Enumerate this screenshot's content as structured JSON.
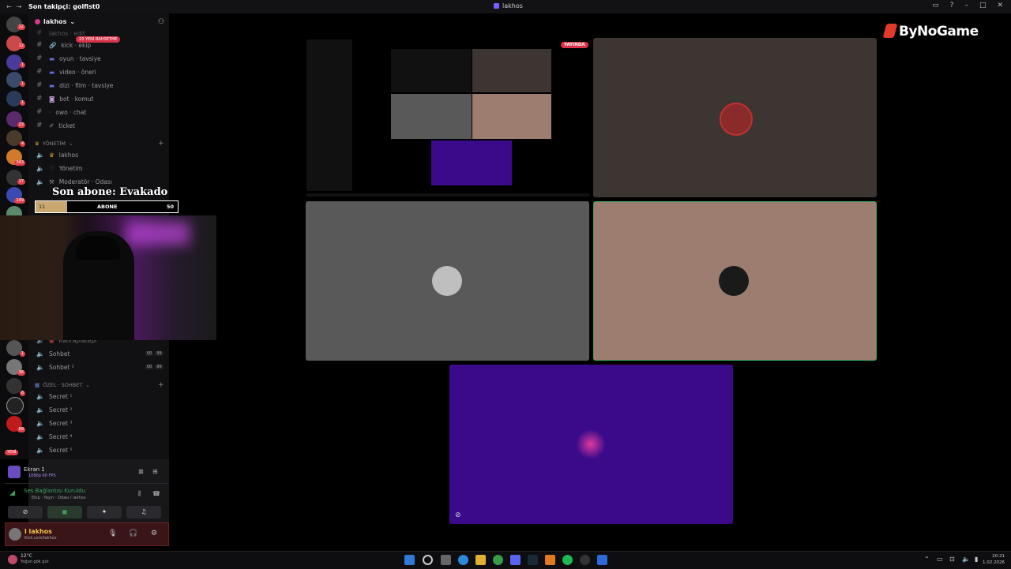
{
  "titlebar": {
    "follower_text": "Son takipçi: golfist0",
    "window_title": "lakhos"
  },
  "server_rail": {
    "badges": [
      "12",
      "12",
      "1",
      "1",
      "1",
      "23",
      "4",
      "343",
      "17",
      "149",
      "1",
      "36",
      "6",
      "69"
    ],
    "new_label": "YENİ"
  },
  "guild": {
    "name": "lakhos"
  },
  "channels": {
    "top_partial": "lakhos · edit",
    "pill": "23 YENİ BAHSETME",
    "text_channels": [
      {
        "name": "kick · ekip",
        "icon": "link-icon"
      },
      {
        "name": "oyun · tavsiye",
        "icon": "gamepad-icon"
      },
      {
        "name": "video · öneri",
        "icon": "video-icon"
      },
      {
        "name": "dizi · film · tavsiye",
        "icon": "film-icon"
      },
      {
        "name": "bot · komut",
        "icon": "robot-icon"
      },
      {
        "name": "owo · chat",
        "icon": "chat-icon"
      },
      {
        "name": "ticket",
        "icon": "ticket-icon"
      }
    ],
    "category_yonetim": "YÖNETİM",
    "voice_yonetim": [
      "lakhos",
      "Yönetim",
      "Moderatör · Odası"
    ],
    "voice_partial": [
      "Kahraplatepi",
      "Sohbet",
      "Sohbet ²"
    ],
    "category_ozel": "ÖZEL · SOHBET",
    "secret_channels": [
      "Secret ¹",
      "Secret ²",
      "Secret ³",
      "Secret ⁴",
      "Secret ⁵"
    ],
    "count_a": "00",
    "count_b": "99"
  },
  "subscriber_overlay": {
    "title": "Son abone: Evakado",
    "left": "11",
    "label": "ABONE",
    "right": "50",
    "progress": 0.22
  },
  "voice_panel": {
    "stream_title": "Ekran 1",
    "stream_quality": "1080p 60 FPS",
    "connection_status": "Ses Bağlantısı Kuruldu",
    "connection_detail": "Ekip · Yayın · Odası / lakhos"
  },
  "user_panel": {
    "name": "l lakhos",
    "status": "Kick.com/lakhos"
  },
  "stage": {
    "live_badge": "YAYINDA",
    "brand": "ByNoGame"
  },
  "taskbar": {
    "temperature": "12°C",
    "weather": "Yoğun gök gür.",
    "time": "20:21",
    "date": "1.02.2026"
  },
  "colors": {
    "accent_green": "#3ba55d",
    "live_red": "#d9334a",
    "purple_tile": "#3a0a8a",
    "tan_tile": "#9c7d70",
    "gray_tile": "#595959"
  }
}
